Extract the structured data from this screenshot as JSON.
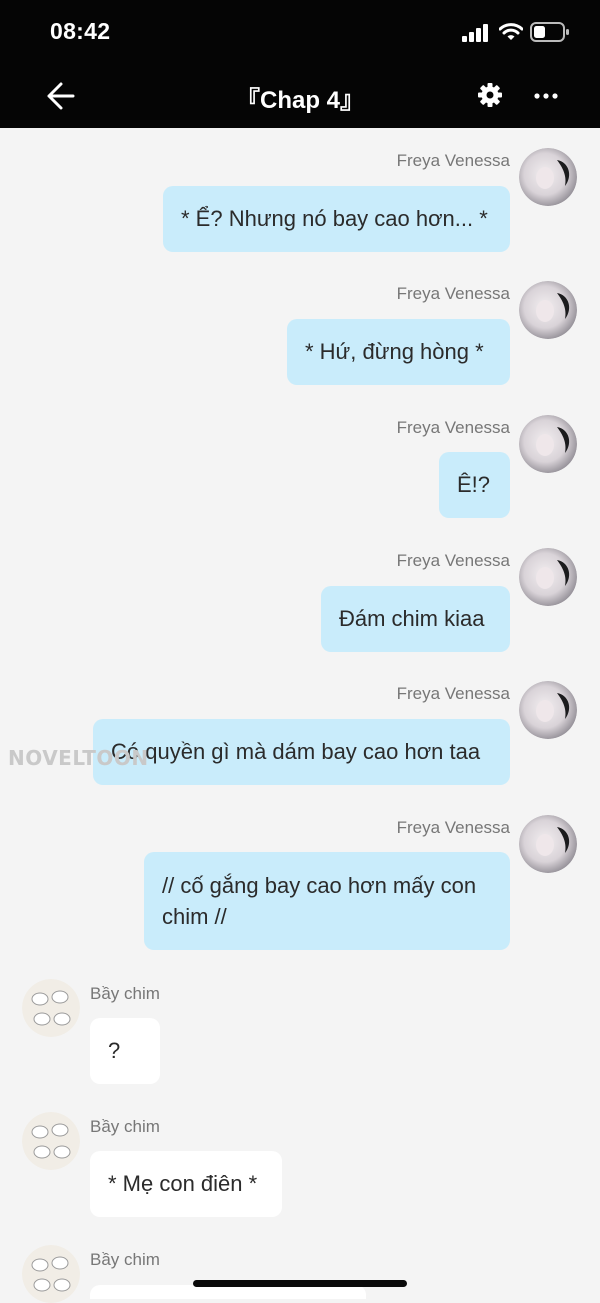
{
  "status_bar": {
    "time": "08:42"
  },
  "header": {
    "title": "『Chap 4』"
  },
  "watermark": "NOVELTOON",
  "messages": [
    {
      "sender": "Freya Venessa",
      "text": "* Ể? Nhưng nó bay cao hơn... *"
    },
    {
      "sender": "Freya Venessa",
      "text": "* Hứ, đừng hòng *"
    },
    {
      "sender": "Freya Venessa",
      "text": "Ê!?"
    },
    {
      "sender": "Freya Venessa",
      "text": "Đám chim kiaa"
    },
    {
      "sender": "Freya Venessa",
      "text": "Có quyền gì mà dám bay cao hơn taa"
    },
    {
      "sender": "Freya Venessa",
      "text": "// cố gắng bay cao hơn mấy con chim //"
    },
    {
      "sender": "Bầy chim",
      "text": "?"
    },
    {
      "sender": "Bầy chim",
      "text": "* Mẹ con điên *"
    },
    {
      "sender": "Bầy chim",
      "text": ""
    }
  ]
}
